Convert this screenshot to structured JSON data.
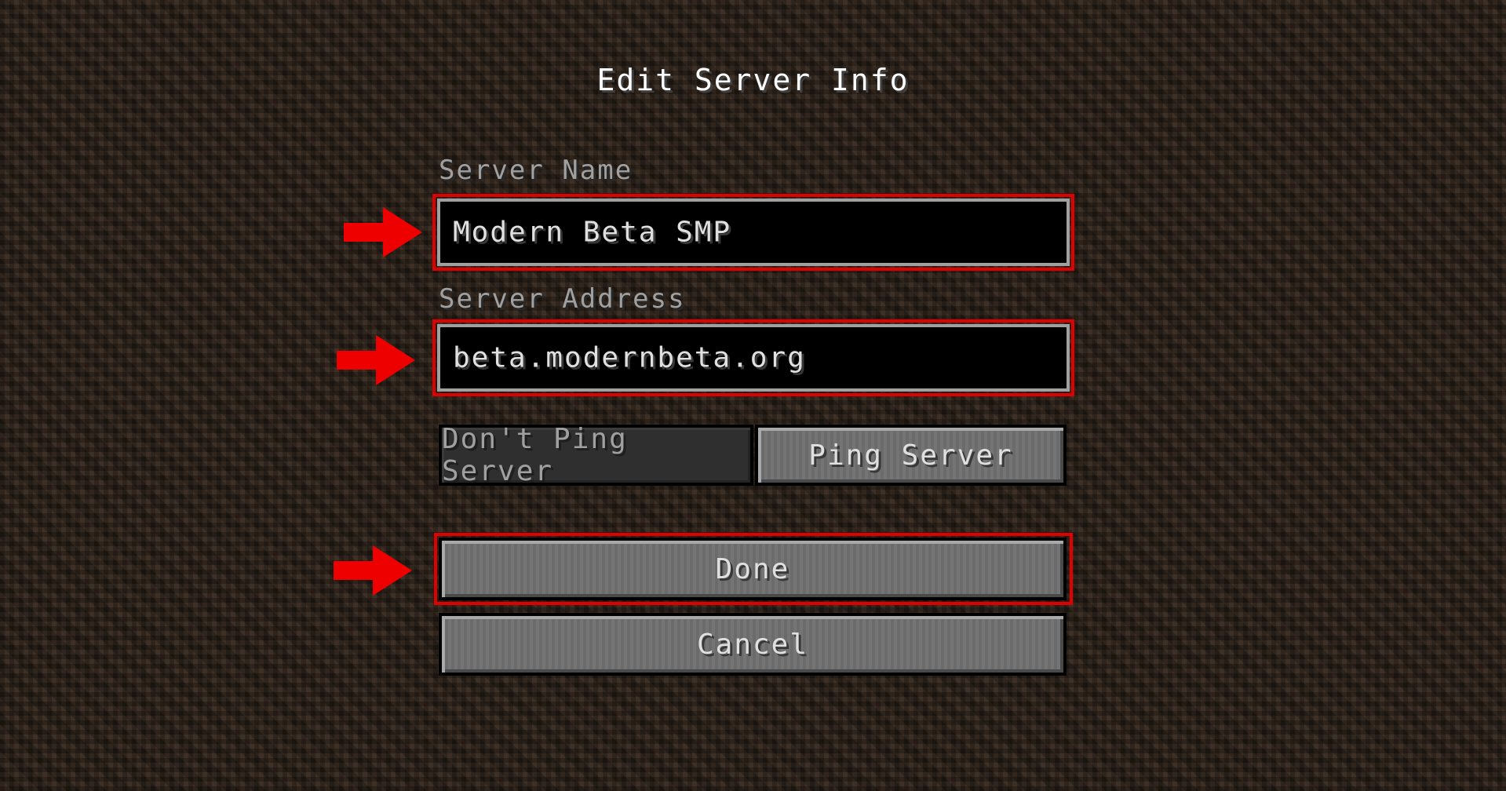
{
  "screen": {
    "title": "Edit Server Info"
  },
  "fields": {
    "name_label": "Server Name",
    "name_value": "Modern Beta SMP",
    "address_label": "Server Address",
    "address_value": "beta.modernbeta.org"
  },
  "buttons": {
    "dont_ping": "Don't Ping Server",
    "ping": "Ping Server",
    "done": "Done",
    "cancel": "Cancel"
  },
  "state": {
    "ping_mode_selected": "Don't Ping Server"
  },
  "annotations": {
    "highlight_color": "#e00000",
    "arrow_color": "#ee0000",
    "highlighted_items": [
      "Server Name",
      "Server Address",
      "Done"
    ]
  },
  "colors": {
    "title_text": "#ffffff",
    "label_text": "#a0a0a0",
    "field_background": "#000000",
    "field_border": "#a0a0a0",
    "button_face": "#6f6f6f",
    "button_disabled_face": "#2f2f2f"
  },
  "icons": [
    "red-arrow-icon"
  ]
}
